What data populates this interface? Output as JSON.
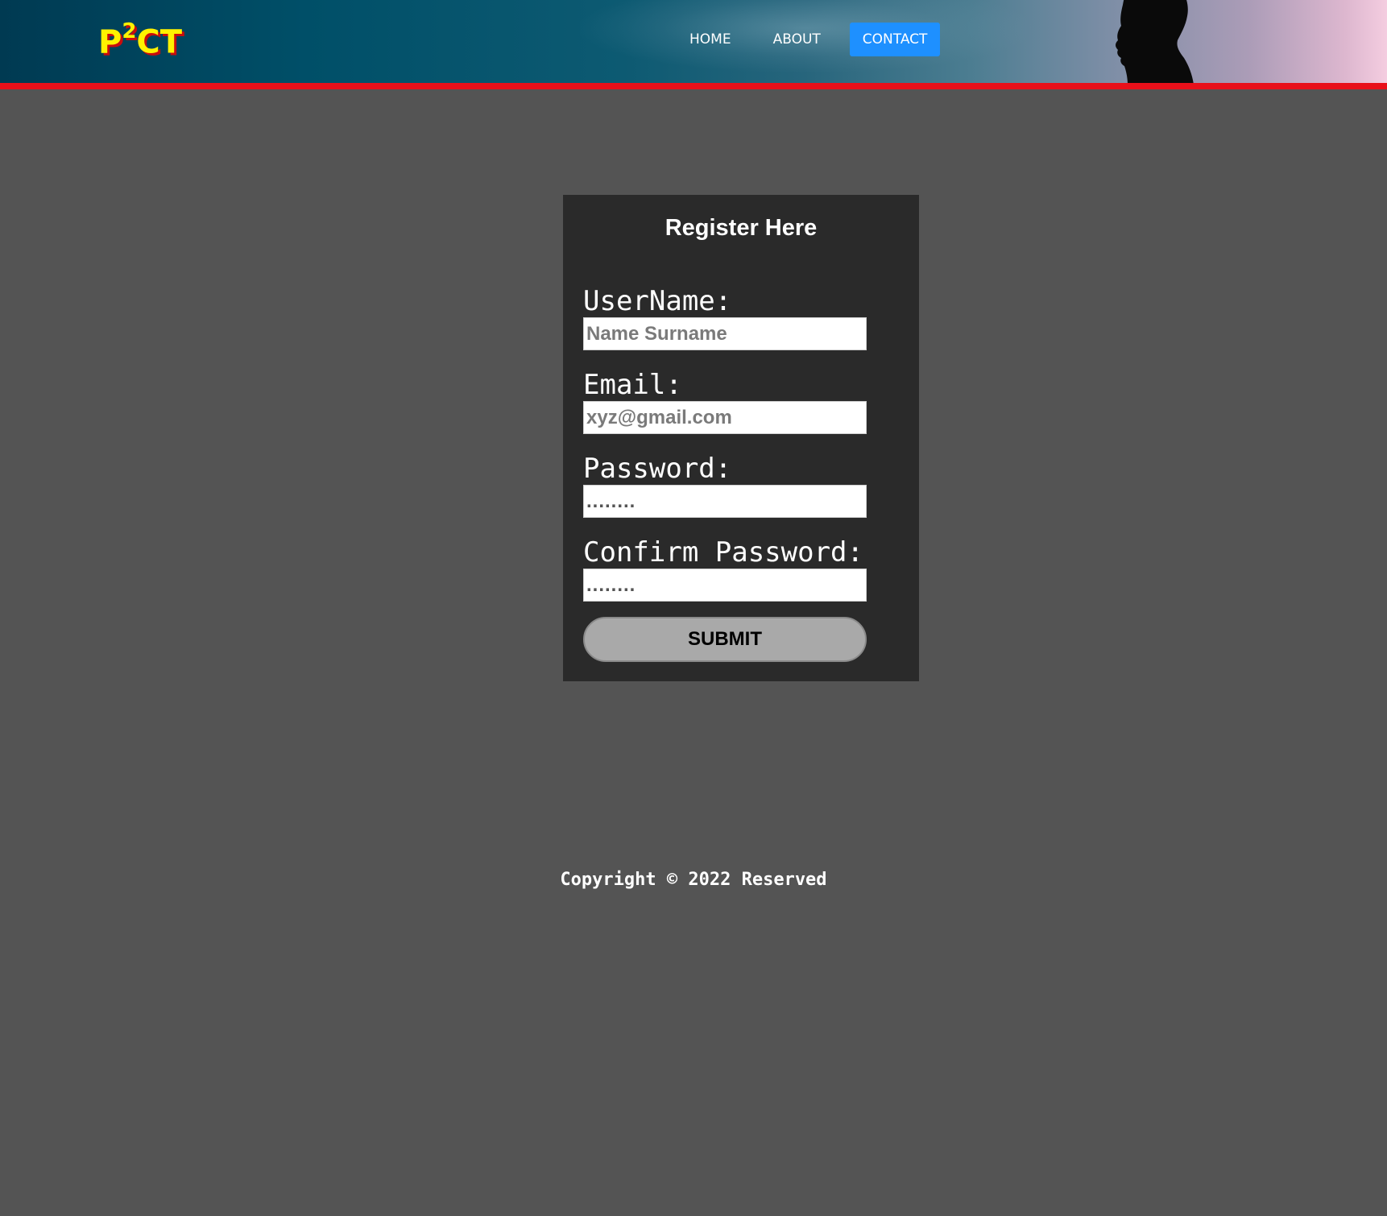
{
  "header": {
    "logo": {
      "prefix": "P",
      "superscript": "2",
      "suffix": "CT"
    },
    "nav": [
      {
        "label": "HOME",
        "active": false
      },
      {
        "label": "ABOUT",
        "active": false
      },
      {
        "label": "CONTACT",
        "active": true
      }
    ],
    "accent_line_color": "#e8101a",
    "active_nav_color": "#1e90ff"
  },
  "form": {
    "title": "Register Here",
    "fields": [
      {
        "label": "UserName:",
        "placeholder": "Name Surname",
        "type": "text"
      },
      {
        "label": "Email:",
        "placeholder": "xyz@gmail.com",
        "type": "email"
      },
      {
        "label": "Password:",
        "placeholder": "........",
        "type": "password"
      },
      {
        "label": "Confirm Password:",
        "placeholder": "........",
        "type": "password"
      }
    ],
    "submit_label": "SUBMIT"
  },
  "footer": {
    "copyright": "Copyright © 2022 Reserved"
  }
}
